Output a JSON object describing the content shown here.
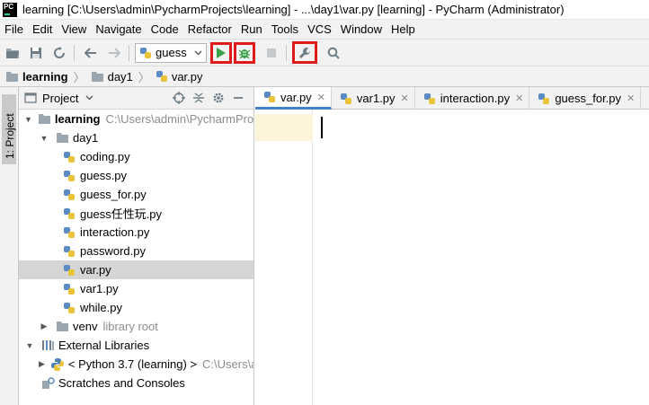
{
  "window": {
    "app_icon": "PC",
    "title": "learning [C:\\Users\\admin\\PycharmProjects\\learning] - ...\\day1\\var.py [learning] - PyCharm (Administrator)"
  },
  "menu": [
    "File",
    "Edit",
    "View",
    "Navigate",
    "Code",
    "Refactor",
    "Run",
    "Tools",
    "VCS",
    "Window",
    "Help"
  ],
  "toolbar": {
    "run_config": "guess",
    "icons": [
      "folder-open-icon",
      "save-icon",
      "sync-icon",
      "back-icon",
      "forward-icon",
      "run-icon",
      "debug-icon",
      "stop-icon",
      "wrench-icon",
      "search-icon"
    ],
    "colors": {
      "run": "#3aa34a",
      "debug": "#3aa34a",
      "highlight": "#e01a1a"
    }
  },
  "breadcrumb": [
    "learning",
    "day1",
    "var.py"
  ],
  "stripe": {
    "label": "1: Project"
  },
  "project_panel": {
    "title": "Project",
    "tree": [
      {
        "label": "learning",
        "hint": "C:\\Users\\admin\\PycharmProjects\\learning",
        "kind": "folder",
        "level": 0,
        "expanded": true,
        "bold": true
      },
      {
        "label": "day1",
        "hint": "",
        "kind": "folder",
        "level": 1,
        "expanded": true
      },
      {
        "label": "coding.py",
        "hint": "",
        "kind": "py",
        "level": 2
      },
      {
        "label": "guess.py",
        "hint": "",
        "kind": "py",
        "level": 2
      },
      {
        "label": "guess_for.py",
        "hint": "",
        "kind": "py",
        "level": 2
      },
      {
        "label": "guess任性玩.py",
        "hint": "",
        "kind": "py",
        "level": 2
      },
      {
        "label": "interaction.py",
        "hint": "",
        "kind": "py",
        "level": 2
      },
      {
        "label": "password.py",
        "hint": "",
        "kind": "py",
        "level": 2
      },
      {
        "label": "var.py",
        "hint": "",
        "kind": "py",
        "level": 2,
        "selected": true
      },
      {
        "label": "var1.py",
        "hint": "",
        "kind": "py",
        "level": 2
      },
      {
        "label": "while.py",
        "hint": "",
        "kind": "py",
        "level": 2
      },
      {
        "label": "venv",
        "hint": "library root",
        "kind": "folder",
        "level": 1,
        "expanded": false
      },
      {
        "label": "External Libraries",
        "hint": "",
        "kind": "libs",
        "level": 0,
        "expanded": true
      },
      {
        "label": "< Python 3.7 (learning) >",
        "hint": "C:\\Users\\admin",
        "kind": "python",
        "level": 1,
        "expanded": false
      },
      {
        "label": "Scratches and Consoles",
        "hint": "",
        "kind": "scratch",
        "level": 0
      }
    ]
  },
  "editor_tabs": [
    {
      "label": "var.py",
      "active": true
    },
    {
      "label": "var1.py",
      "active": false
    },
    {
      "label": "interaction.py",
      "active": false
    },
    {
      "label": "guess_for.py",
      "active": false
    }
  ]
}
